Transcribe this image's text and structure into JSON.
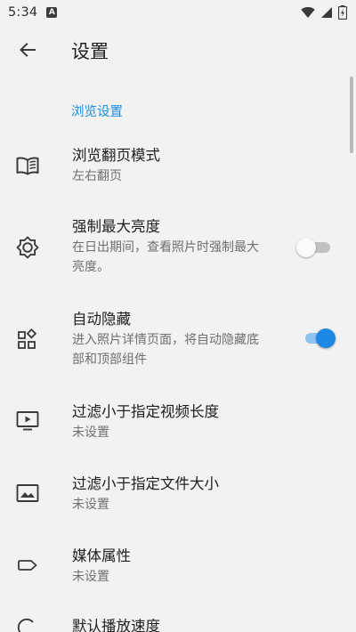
{
  "status_bar": {
    "time": "5:34",
    "notification": "A"
  },
  "app_bar": {
    "title": "设置"
  },
  "section": {
    "header": "浏览设置"
  },
  "items": [
    {
      "icon": "book-icon",
      "title": "浏览翻页模式",
      "summary": "左右翻页"
    },
    {
      "icon": "brightness-icon",
      "title": "强制最大亮度",
      "summary": "在日出期间，查看照片时强制最大亮度。",
      "toggle": false
    },
    {
      "icon": "widgets-icon",
      "title": "自动隐藏",
      "summary": "进入照片详情页面，将自动隐藏底部和顶部组件",
      "toggle": true
    },
    {
      "icon": "video-icon",
      "title": "过滤小于指定视频长度",
      "summary": "未设置"
    },
    {
      "icon": "image-icon",
      "title": "过滤小于指定文件大小",
      "summary": "未设置"
    },
    {
      "icon": "label-icon",
      "title": "媒体属性",
      "summary": "未设置"
    },
    {
      "icon": "speed-icon",
      "title": "默认播放速度"
    }
  ],
  "colors": {
    "accent": "#1e88e5",
    "section_header": "#1a8fe3",
    "background": "#f2f2f2"
  }
}
